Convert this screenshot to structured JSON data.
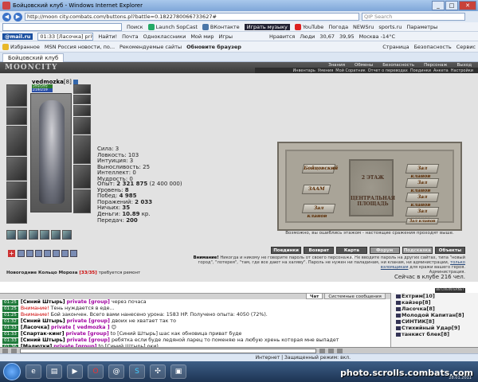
{
  "window": {
    "title": "Бойцовский клуб - Windows Internet Explorer",
    "btn_min": "_",
    "btn_max": "□",
    "btn_close": "✕"
  },
  "address": {
    "url": "http://moon city.combats.com/buttons.pl?battle=0.1822780066733627#",
    "search_placeholder": "QIP Search",
    "back": "◀",
    "fwd": "▶"
  },
  "toolbar1": {
    "items": [
      "Поиск",
      "Launch SopCast",
      "ВКонтакте",
      "Играть музыку",
      "YouTube",
      "Погода",
      "NEWSru",
      "sports.ru",
      "Параметры"
    ]
  },
  "toolbar2": {
    "mail": "@mail.ru",
    "search": "01:33 [Ласочка] priv",
    "find": "Найти!",
    "items": [
      "Почта",
      "Одноклассники",
      "Мой мир",
      "Игры",
      "Нравится",
      "Люди",
      "30,67",
      "39,95",
      "Москва -14°C"
    ]
  },
  "favbar": {
    "fav": "Избранное",
    "items": [
      "MSN Россия новости, по...",
      "Рекомендуемые сайты",
      "Обновите браузер"
    ],
    "right": [
      "Страница",
      "Безопасность",
      "Сервис"
    ]
  },
  "tab": {
    "label": "Бойцовский клуб"
  },
  "mooncity": {
    "logo": "MOONCITY",
    "nav1": [
      "Знания",
      "Обмены",
      "Безопасность",
      "Персонаж",
      "Выход"
    ],
    "nav2": [
      "Инвентарь",
      "Умения",
      "Мой Соратник",
      "Отчет о переводах",
      "Поединки",
      "Анкета",
      "Настройки"
    ]
  },
  "character": {
    "name": "vedmozka",
    "level": "[8]",
    "hp": "595/595",
    "mp": "219/219",
    "stats": [
      {
        "k": "Сила",
        "v": "3"
      },
      {
        "k": "Ловкость",
        "v": "103"
      },
      {
        "k": "Интуиция",
        "v": "3"
      },
      {
        "k": "Выносливость",
        "v": "25"
      },
      {
        "k": "Интеллект",
        "v": "0"
      },
      {
        "k": "Мудрость",
        "v": "0"
      }
    ],
    "progress": [
      {
        "k": "Опыт",
        "v": "2 321 875",
        "extra": "(2 400 000)"
      },
      {
        "k": "Уровень",
        "v": "8"
      },
      {
        "k": "Побед",
        "v": "4 985"
      },
      {
        "k": "Поражений",
        "v": "2 033"
      },
      {
        "k": "Ничьих",
        "v": "35"
      },
      {
        "k": "Деньги",
        "v": "10.89",
        "extra": "кр."
      },
      {
        "k": "Передач",
        "v": "200"
      }
    ],
    "repair_item": "Новогодние Кольцо Мороза",
    "repair_count": "[33/35]",
    "repair_text": "требуется ремонт"
  },
  "map": {
    "floor": "2 ЭТАЖ",
    "square1": "ЦЕНТРАЛЬНАЯ",
    "square2": "ПЛОЩАДЬ",
    "rooms": [
      "Бойцовский",
      "Зал кланов",
      "Зал кланов",
      "ЗААМ",
      "Зал кланов",
      "Зал кланов",
      "Зал кланов",
      "Зал кланов"
    ],
    "note": "Возможно, вы ошиблись этажом - настоящие сражения проходят выше."
  },
  "actions": [
    "Поединки",
    "Возврат",
    "Карта клуба",
    "Форум",
    "Подсказка",
    "Объекты"
  ],
  "warning": {
    "head": "Внимание!",
    "text": "Никогда и никому не говорите пароль от своего персонажа. Не вводите пароль на других сайтах, типа \"новый город\", \"лотерея\", \"там, где все дают на халяву\". Пароль не нужен ни паладинам, ни кланам, ни администрации,",
    "link": "только взломщикам",
    "tail": "для кражи вашего героя.",
    "sign": "Администрация."
  },
  "online": "Сейчас в клубе 216 чел.",
  "stamp": [
    "BB LIVEINTERNET",
    "TOP.MAIL.RU"
  ],
  "chat": {
    "tabs": [
      "Чат",
      "Системные сообщения"
    ],
    "lines": [
      {
        "t": "01:25",
        "who": "[Синий Штырь]",
        "tag": "private [group]",
        "msg": "через почаса"
      },
      {
        "t": "01:25",
        "who": "",
        "tag": "Внимание!",
        "msg": "Тень нуждается в еде..."
      },
      {
        "t": "01:25",
        "who": "",
        "tag": "Внимание!",
        "msg": "Бой закончен. Всего вами нанесено урона: 1583 HP. Получено опыта: 4050 (72%)."
      },
      {
        "t": "01:32",
        "who": "[Синий Штырь]",
        "tag": "private [group]",
        "msg": "двоих не хватает так то"
      },
      {
        "t": "01:33",
        "who": "[Ласочка]",
        "tag": "private [ vedmozka ]",
        "msg": "😊"
      },
      {
        "t": "01:33",
        "who": "[Спартак-кинг]",
        "tag": "private [group]",
        "msg": "to [Синий Штырь] шас как обновица приват буде"
      },
      {
        "t": "01:33",
        "who": "[Синий Штырь]",
        "tag": "private [group]",
        "msg": "ребятка если буде ледяной ларец то поменяю на любую хрень которая мне выпадет"
      },
      {
        "t": "01:36",
        "who": "[Малютки]",
        "tag": "private [group]",
        "msg": "to [Синий Штырь] оки)"
      }
    ]
  },
  "users": [
    "Ехтрим[10]",
    "кайзер[8]",
    "Ласочка[8]",
    "Молодой Капитан[8]",
    "СИНТИК[8]",
    "Стихийный Удар[9]",
    "танкист блек[8]"
  ],
  "statusbar": "Интернет | Защищенный режим: вкл.",
  "taskbar": {
    "watermark": "photo.scrolls.combats.com",
    "clock": "28.01.2011"
  }
}
